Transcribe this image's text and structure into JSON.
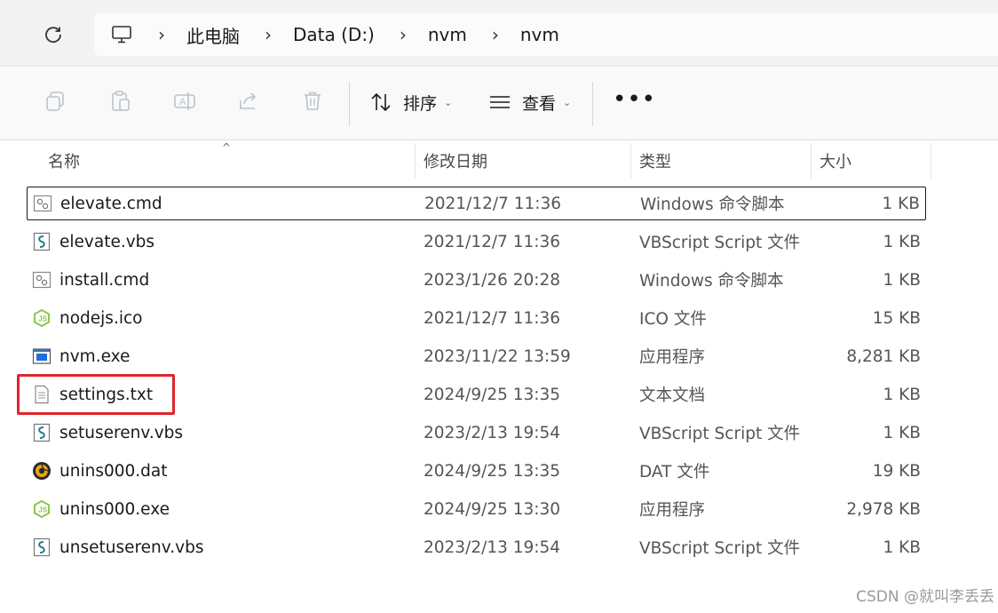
{
  "address_bar": {
    "breadcrumbs": [
      "此电脑",
      "Data (D:)",
      "nvm",
      "nvm"
    ],
    "root_icon": "monitor-icon"
  },
  "toolbar": {
    "sort_label": "排序",
    "view_label": "查看",
    "more_label": "•••"
  },
  "columns": {
    "name": "名称",
    "date": "修改日期",
    "type": "类型",
    "size": "大小"
  },
  "files": [
    {
      "name": "elevate.cmd",
      "date": "2021/12/7 11:36",
      "type": "Windows 命令脚本",
      "size": "1 KB",
      "icon": "cmd-file-icon"
    },
    {
      "name": "elevate.vbs",
      "date": "2021/12/7 11:36",
      "type": "VBScript Script 文件",
      "size": "1 KB",
      "icon": "vbs-file-icon"
    },
    {
      "name": "install.cmd",
      "date": "2023/1/26 20:28",
      "type": "Windows 命令脚本",
      "size": "1 KB",
      "icon": "cmd-file-icon"
    },
    {
      "name": "nodejs.ico",
      "date": "2021/12/7 11:36",
      "type": "ICO 文件",
      "size": "15 KB",
      "icon": "nodejs-icon"
    },
    {
      "name": "nvm.exe",
      "date": "2023/11/22 13:59",
      "type": "应用程序",
      "size": "8,281 KB",
      "icon": "exe-file-icon"
    },
    {
      "name": "settings.txt",
      "date": "2024/9/25 13:35",
      "type": "文本文档",
      "size": "1 KB",
      "icon": "text-file-icon"
    },
    {
      "name": "setuserenv.vbs",
      "date": "2023/2/13 19:54",
      "type": "VBScript Script 文件",
      "size": "1 KB",
      "icon": "vbs-file-icon"
    },
    {
      "name": "unins000.dat",
      "date": "2024/9/25 13:35",
      "type": "DAT 文件",
      "size": "19 KB",
      "icon": "dat-file-icon"
    },
    {
      "name": "unins000.exe",
      "date": "2024/9/25 13:30",
      "type": "应用程序",
      "size": "2,978 KB",
      "icon": "nodejs-icon"
    },
    {
      "name": "unsetuserenv.vbs",
      "date": "2023/2/13 19:54",
      "type": "VBScript Script 文件",
      "size": "1 KB",
      "icon": "vbs-file-icon"
    }
  ],
  "watermark": "CSDN @就叫李丢丢",
  "colors": {
    "highlight": "#e0262d",
    "nodejs_green": "#8cc84b"
  }
}
